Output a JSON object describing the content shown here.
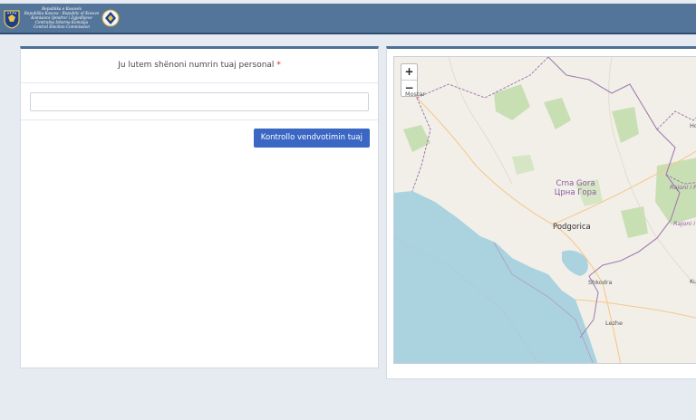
{
  "header": {
    "lines": [
      "Republika e Kosovës",
      "Republika Kosova - Republic of Kosovo",
      "Komisioni Qendror i Zgjedhjeve",
      "Centralna Izborna Komisija",
      "Central Election Commission"
    ]
  },
  "form": {
    "label": "Ju lutem shënoni numrin tuaj personal",
    "required_mark": "*",
    "input_value": "",
    "input_placeholder": "",
    "button_label": "Kontrollo vendvotimin tuaj"
  },
  "map": {
    "zoom_in": "+",
    "zoom_out": "−",
    "country_latin": "Crna Gora",
    "country_cyrillic": "Црна Гора",
    "capital": "Podgorica",
    "labels": [
      "Mostar",
      "Shkodra",
      "Lezhe",
      "Ho",
      "Rajoni i P",
      "Rajoni i",
      "Ku"
    ],
    "colors": {
      "sea": "#aad3df",
      "land": "#f2efe9",
      "forest": "#c8dfb4",
      "border": "#a07bb0"
    }
  },
  "colors": {
    "header_bg": "#54759a",
    "accent": "#4d6f95",
    "button": "#3a66c4",
    "page_bg": "#e6eaf1"
  }
}
